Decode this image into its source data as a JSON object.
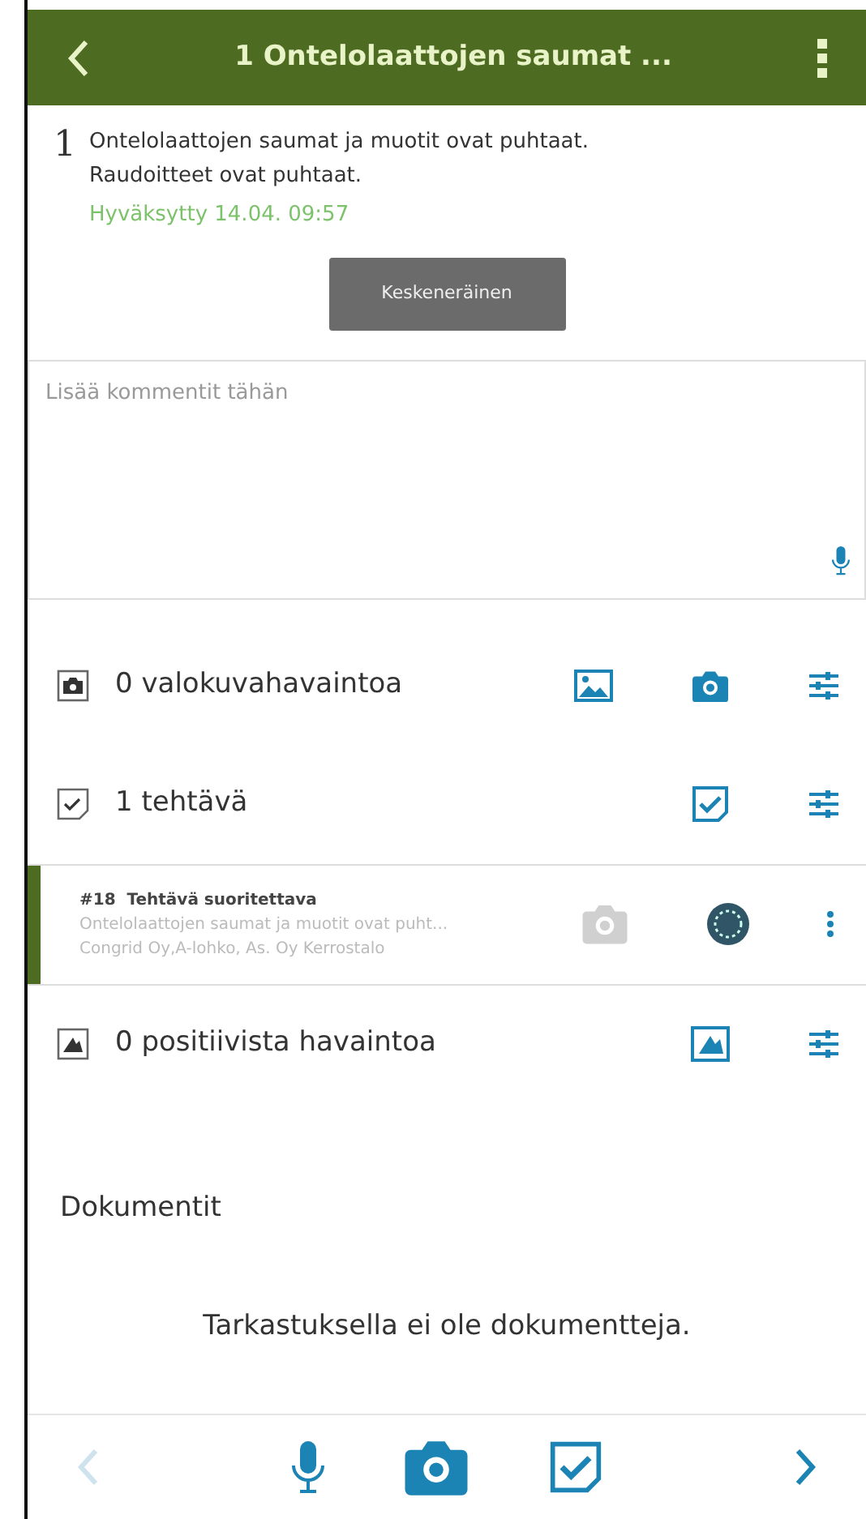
{
  "header": {
    "title": "1 Ontelolaattojen saumat ..."
  },
  "item": {
    "number": "1",
    "text_lines": [
      "Ontelolaattojen saumat ja muotit ovat puhtaat.",
      "Raudoitteet ovat puhtaat."
    ],
    "status": "Hyväksytty 14.04. 09:57",
    "button": "Keskeneräinen"
  },
  "comment": {
    "placeholder": "Lisää kommentit tähän"
  },
  "sections": [
    {
      "kind": "photo",
      "label": "0 valokuvahavaintoa",
      "actions": [
        {
          "kind": "gallery"
        },
        {
          "kind": "camera"
        },
        {
          "kind": "filter"
        }
      ]
    },
    {
      "kind": "task",
      "label": "1 tehtävä",
      "actions": [
        {
          "kind": "task"
        },
        {
          "kind": "filter"
        }
      ],
      "tasks": [
        {
          "id": "#18",
          "title": "Tehtävä suoritettava",
          "description": "Ontelolaattojen saumat ja muotit ovat puht...",
          "location": "Congrid Oy,A-lohko, As. Oy Kerrostalo",
          "camera_disabled": true
        }
      ]
    },
    {
      "kind": "positive",
      "label": "0 positiivista havaintoa",
      "actions": [
        {
          "kind": "positive"
        },
        {
          "kind": "filter"
        }
      ]
    }
  ],
  "documents": {
    "heading": "Dokumentit",
    "empty": "Tarkastuksella ei ole dokumentteja."
  },
  "bottom_bar": {
    "prev_disabled": true,
    "next_disabled": false
  }
}
